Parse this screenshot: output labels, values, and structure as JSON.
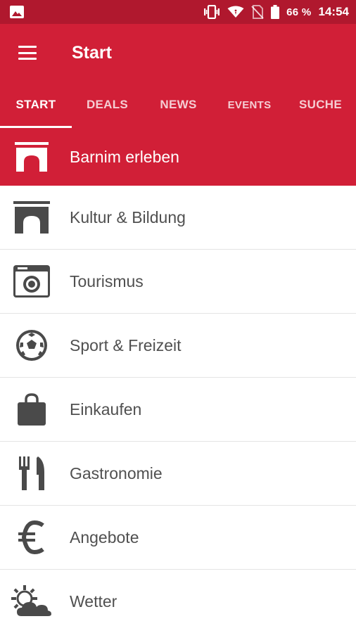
{
  "status_bar": {
    "battery_text": "66 %",
    "time": "14:54",
    "icons": [
      "image-icon",
      "vibrate-icon",
      "wifi-icon",
      "no-sim-icon",
      "battery-icon"
    ]
  },
  "app_bar": {
    "title": "Start",
    "menu_icon": "hamburger-menu-icon"
  },
  "tabs": [
    {
      "label": "START",
      "active": true
    },
    {
      "label": "DEALS",
      "active": false
    },
    {
      "label": "NEWS",
      "active": false
    },
    {
      "label": "EVENTS",
      "active": false
    },
    {
      "label": "SUCHE",
      "active": false
    }
  ],
  "hero": {
    "label": "Barnim erleben",
    "icon": "arch-gate-icon"
  },
  "categories": [
    {
      "label": "Kultur & Bildung",
      "icon": "arch-gate-icon"
    },
    {
      "label": "Tourismus",
      "icon": "camera-icon"
    },
    {
      "label": "Sport & Freizeit",
      "icon": "soccer-ball-icon"
    },
    {
      "label": "Einkaufen",
      "icon": "shopping-bag-icon"
    },
    {
      "label": "Gastronomie",
      "icon": "fork-knife-icon"
    },
    {
      "label": "Angebote",
      "icon": "euro-icon"
    },
    {
      "label": "Wetter",
      "icon": "sun-cloud-icon"
    }
  ],
  "colors": {
    "primary": "#d11f37",
    "status_bar": "#b0182e",
    "text": "#505050",
    "icon": "#4a4a4a"
  }
}
